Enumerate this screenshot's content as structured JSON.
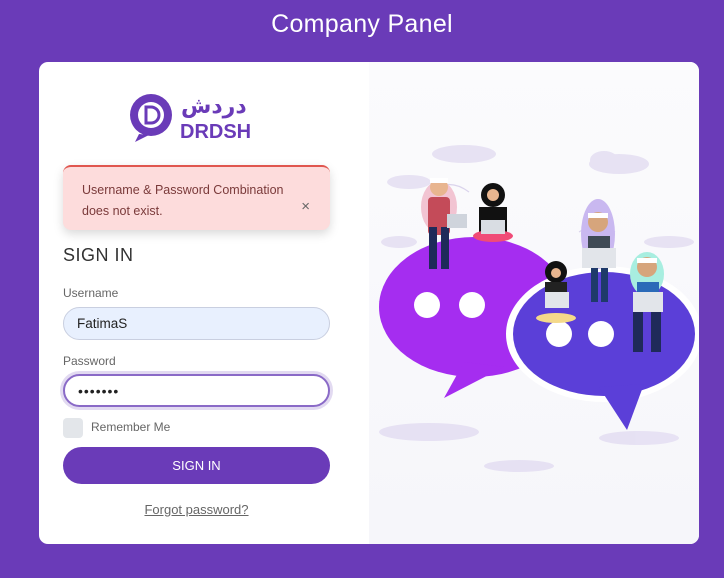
{
  "page": {
    "title": "Company Panel"
  },
  "logo": {
    "arabic": "دردش",
    "latin": "DRDSH"
  },
  "alert": {
    "message": "Username & Password Combination does not exist.",
    "close_icon": "×"
  },
  "form": {
    "heading": "SIGN IN",
    "username_label": "Username",
    "username_value": "FatimaS",
    "password_label": "Password",
    "password_value": "•••••••",
    "remember_label": "Remember Me",
    "signin_label": "SIGN IN",
    "forgot_label": "Forgot password?"
  },
  "colors": {
    "brand": "#6a3bb8",
    "alert_bg": "#fddcdc",
    "bubble_purple": "#a52df0",
    "bubble_blue": "#5b3fd8"
  }
}
